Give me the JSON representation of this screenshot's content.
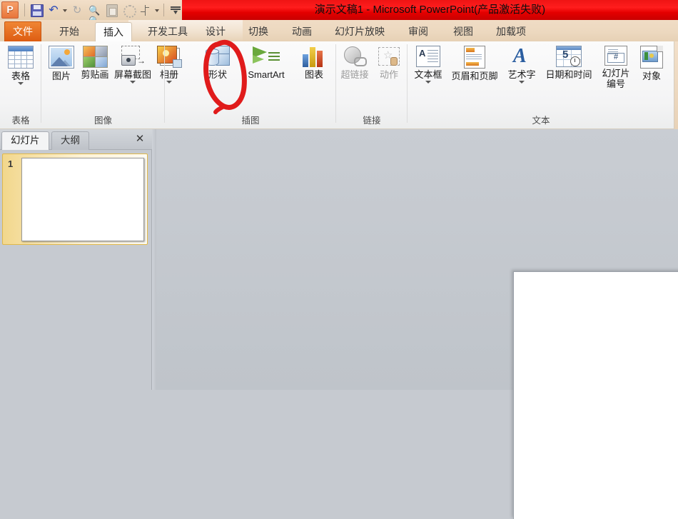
{
  "window": {
    "title": "演示文稿1 - Microsoft PowerPoint(产品激活失败)",
    "accent_red": "#e40000",
    "titlebar_beige": "#ecd8bf"
  },
  "quick_access": {
    "app_logo": "powerpoint-logo",
    "buttons": [
      {
        "name": "save-icon",
        "label": "保存"
      },
      {
        "name": "undo-icon",
        "label": "撤消"
      },
      {
        "name": "undo-dropdown-caret",
        "label": ""
      },
      {
        "name": "redo-icon",
        "label": "重复"
      },
      {
        "name": "find-icon",
        "label": "查找"
      },
      {
        "name": "paste-icon",
        "label": "粘贴"
      },
      {
        "name": "circle-icon",
        "label": "形状"
      },
      {
        "name": "chart-icon",
        "label": "图表"
      },
      {
        "name": "customize-qat-caret",
        "label": ""
      },
      {
        "name": "ribbon-options-icon",
        "label": ""
      }
    ]
  },
  "tabs": {
    "file": "文件",
    "items": [
      {
        "label": "开始",
        "active": false
      },
      {
        "label": "插入",
        "active": true
      },
      {
        "label": "开发工具",
        "active": false
      },
      {
        "label": "设计",
        "active": false
      },
      {
        "label": "切换",
        "active": false
      },
      {
        "label": "动画",
        "active": false
      },
      {
        "label": "幻灯片放映",
        "active": false
      },
      {
        "label": "审阅",
        "active": false
      },
      {
        "label": "视图",
        "active": false
      },
      {
        "label": "加载项",
        "active": false
      }
    ]
  },
  "ribbon": {
    "groups": [
      {
        "label": "表格",
        "items": [
          {
            "label": "表格",
            "icon": "table-icon",
            "dropdown": true,
            "disabled": false
          }
        ]
      },
      {
        "label": "图像",
        "items": [
          {
            "label": "图片",
            "icon": "picture-icon",
            "dropdown": false,
            "disabled": false
          },
          {
            "label": "剪贴画",
            "icon": "clip-art-icon",
            "dropdown": false,
            "disabled": false
          },
          {
            "label": "屏幕截图",
            "icon": "screenshot-icon",
            "dropdown": true,
            "disabled": false
          },
          {
            "label": "相册",
            "icon": "photo-album-icon",
            "dropdown": true,
            "disabled": false
          }
        ]
      },
      {
        "label": "插图",
        "items": [
          {
            "label": "形状",
            "icon": "shapes-icon",
            "dropdown": false,
            "disabled": false
          },
          {
            "label": "SmartArt",
            "icon": "smartart-icon",
            "dropdown": false,
            "disabled": false
          },
          {
            "label": "图表",
            "icon": "chart-icon",
            "dropdown": false,
            "disabled": false
          }
        ]
      },
      {
        "label": "链接",
        "items": [
          {
            "label": "超链接",
            "icon": "hyperlink-icon",
            "dropdown": false,
            "disabled": true
          },
          {
            "label": "动作",
            "icon": "action-icon",
            "dropdown": false,
            "disabled": true
          }
        ]
      },
      {
        "label": "文本",
        "items": [
          {
            "label": "文本框",
            "icon": "text-box-icon",
            "dropdown": true,
            "disabled": false
          },
          {
            "label": "页眉和页脚",
            "icon": "header-footer-icon",
            "dropdown": false,
            "disabled": false
          },
          {
            "label": "艺术字",
            "icon": "wordart-icon",
            "dropdown": true,
            "disabled": false
          },
          {
            "label": "日期和时间",
            "icon": "date-time-icon",
            "dropdown": false,
            "disabled": false
          },
          {
            "label": "幻灯片编号",
            "icon": "slide-number-icon",
            "dropdown": false,
            "disabled": false
          },
          {
            "label": "对象",
            "icon": "object-icon",
            "dropdown": false,
            "disabled": false
          }
        ]
      }
    ]
  },
  "annotation": {
    "shape": "hand-drawn-red-circle",
    "color": "#e01b1b",
    "targets": "形状"
  },
  "left_pane": {
    "tabs": [
      {
        "label": "幻灯片",
        "active": true
      },
      {
        "label": "大纲",
        "active": false
      }
    ],
    "close_label": "✕",
    "slides": [
      {
        "number": "1",
        "selected": true
      }
    ]
  }
}
